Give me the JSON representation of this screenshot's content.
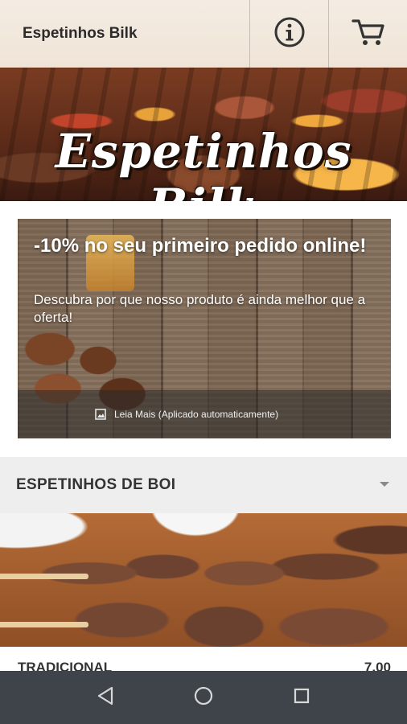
{
  "appbar": {
    "title": "Espetinhos Bilk",
    "info_icon": "info-icon",
    "cart_icon": "cart-icon"
  },
  "hero": {
    "logo_text": "Espetinhos Bilk"
  },
  "promo": {
    "headline": "-10% no seu primeiro pedido online!",
    "description": "Descubra por que nosso produto é ainda melhor que a oferta!",
    "more_label": "Leia Mais (Aplicado automaticamente)",
    "more_icon": "image-icon"
  },
  "category": {
    "name": "ESPETINHOS DE BOI",
    "toggle_icon": "caret-down-icon"
  },
  "product": {
    "name": "TRADICIONAL",
    "price": "7,00"
  },
  "navbar": {
    "back_icon": "back-triangle-icon",
    "home_icon": "home-circle-icon",
    "recents_icon": "recents-square-icon"
  },
  "colors": {
    "appbar_bg": "#f1e7da",
    "category_bg": "#eeeeee",
    "navbar_bg": "#3e4449",
    "text_dark": "#333333"
  }
}
